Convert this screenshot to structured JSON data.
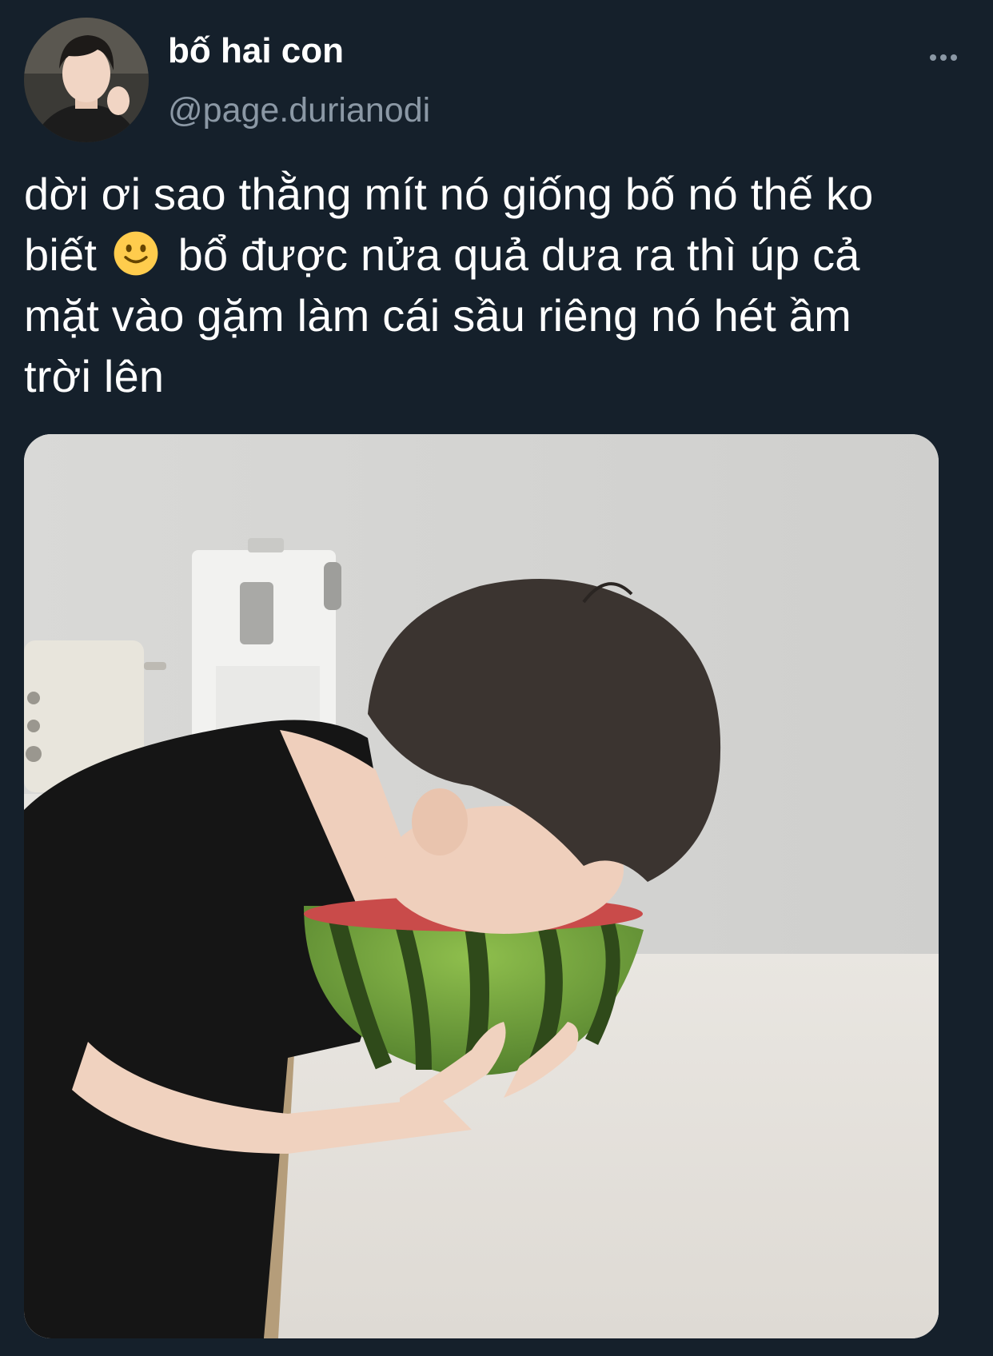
{
  "tweet": {
    "display_name": "bố hai con",
    "handle": "@page.durianodi",
    "text_lines": [
      "dời ơi sao thằng mít nó giống bố nó thế ko",
      "biết",
      "bổ được nửa quả dưa ra thì úp cả",
      "mặt vào gặm làm cái sầu riêng nó hét ầm",
      "trời lên"
    ],
    "emoji": "slightly-smiling-face-icon",
    "more_icon": "more-horizontal-icon"
  },
  "colors": {
    "background": "#15202b",
    "text_primary": "#ffffff",
    "text_secondary": "#8b98a5"
  }
}
